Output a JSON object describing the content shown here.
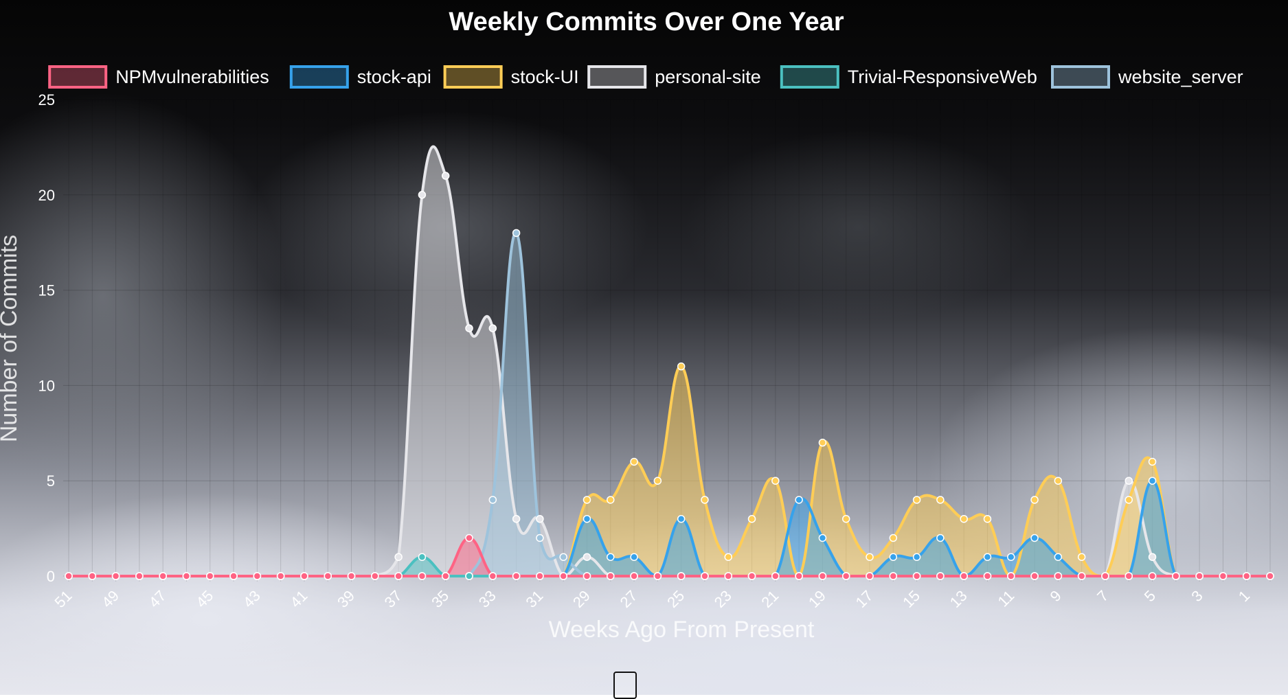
{
  "chart_data": {
    "type": "line",
    "title": "Weekly Commits Over One Year",
    "xlabel": "Weeks Ago From Present",
    "ylabel": "Number of Commits",
    "ylim": [
      0,
      25
    ],
    "yticks": [
      0,
      5,
      10,
      15,
      20,
      25
    ],
    "grid": true,
    "legend_position": "top",
    "x": [
      51,
      50,
      49,
      48,
      47,
      46,
      45,
      44,
      43,
      42,
      41,
      40,
      39,
      38,
      37,
      36,
      35,
      34,
      33,
      32,
      31,
      30,
      29,
      28,
      27,
      26,
      25,
      24,
      23,
      22,
      21,
      20,
      19,
      18,
      17,
      16,
      15,
      14,
      13,
      12,
      11,
      10,
      9,
      8,
      7,
      6,
      5,
      4,
      3,
      2,
      1,
      0
    ],
    "x_tick_labels": [
      "51",
      "49",
      "47",
      "45",
      "43",
      "41",
      "39",
      "37",
      "35",
      "33",
      "31",
      "29",
      "27",
      "25",
      "23",
      "21",
      "19",
      "17",
      "15",
      "13",
      "11",
      "9",
      "7",
      "5",
      "3",
      "1"
    ],
    "series": [
      {
        "name": "NPMvulnerabilities",
        "color": "#ff6384",
        "values": [
          0,
          0,
          0,
          0,
          0,
          0,
          0,
          0,
          0,
          0,
          0,
          0,
          0,
          0,
          0,
          0,
          0,
          2,
          0,
          0,
          0,
          0,
          0,
          0,
          0,
          0,
          0,
          0,
          0,
          0,
          0,
          0,
          0,
          0,
          0,
          0,
          0,
          0,
          0,
          0,
          0,
          0,
          0,
          0,
          0,
          0,
          0,
          0,
          0,
          0,
          0,
          0
        ]
      },
      {
        "name": "stock-api",
        "color": "#36a2eb",
        "values": [
          0,
          0,
          0,
          0,
          0,
          0,
          0,
          0,
          0,
          0,
          0,
          0,
          0,
          0,
          0,
          0,
          0,
          0,
          0,
          0,
          0,
          0,
          3,
          1,
          1,
          0,
          3,
          0,
          0,
          0,
          0,
          4,
          2,
          0,
          0,
          1,
          1,
          2,
          0,
          1,
          1,
          2,
          1,
          0,
          0,
          0,
          5,
          0,
          0,
          0,
          0,
          0
        ]
      },
      {
        "name": "stock-UI",
        "color": "#ffcd56",
        "values": [
          0,
          0,
          0,
          0,
          0,
          0,
          0,
          0,
          0,
          0,
          0,
          0,
          0,
          0,
          0,
          0,
          0,
          0,
          0,
          0,
          0,
          0,
          4,
          4,
          6,
          5,
          11,
          4,
          1,
          3,
          5,
          0,
          7,
          3,
          1,
          2,
          4,
          4,
          3,
          3,
          0,
          4,
          5,
          1,
          0,
          4,
          6,
          0,
          0,
          0,
          0,
          0
        ]
      },
      {
        "name": "personal-site",
        "color": "#e6e6ea",
        "values": [
          0,
          0,
          0,
          0,
          0,
          0,
          0,
          0,
          0,
          0,
          0,
          0,
          0,
          0,
          1,
          20,
          21,
          13,
          13,
          3,
          3,
          0,
          1,
          0,
          0,
          0,
          0,
          0,
          0,
          0,
          0,
          0,
          0,
          0,
          0,
          0,
          0,
          0,
          0,
          0,
          0,
          0,
          0,
          0,
          0,
          5,
          1,
          0,
          0,
          0,
          0,
          0
        ]
      },
      {
        "name": "Trivial-ResponsiveWeb",
        "color": "#4bc0c0",
        "values": [
          0,
          0,
          0,
          0,
          0,
          0,
          0,
          0,
          0,
          0,
          0,
          0,
          0,
          0,
          0,
          1,
          0,
          0,
          0,
          0,
          0,
          0,
          0,
          0,
          0,
          0,
          0,
          0,
          0,
          0,
          0,
          0,
          0,
          0,
          0,
          0,
          0,
          0,
          0,
          0,
          0,
          0,
          0,
          0,
          0,
          0,
          0,
          0,
          0,
          0,
          0,
          0
        ]
      },
      {
        "name": "website_server",
        "color": "#9ec3dc",
        "values": [
          0,
          0,
          0,
          0,
          0,
          0,
          0,
          0,
          0,
          0,
          0,
          0,
          0,
          0,
          0,
          0,
          0,
          0,
          4,
          18,
          2,
          1,
          0,
          0,
          0,
          0,
          0,
          0,
          0,
          0,
          0,
          0,
          0,
          0,
          0,
          0,
          0,
          0,
          0,
          0,
          0,
          0,
          0,
          0,
          0,
          0,
          0,
          0,
          0,
          0,
          0,
          0
        ]
      }
    ]
  }
}
